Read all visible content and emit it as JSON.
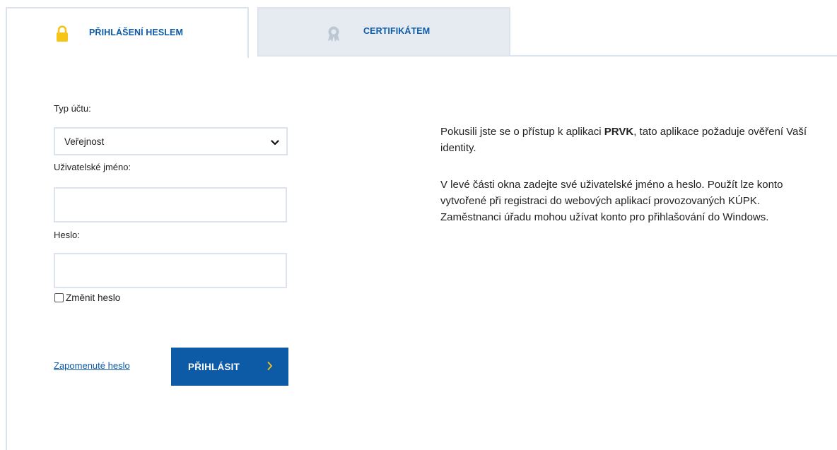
{
  "tabs": [
    {
      "label": "PŘIHLÁŠENÍ HESLEM",
      "icon": "lock-icon",
      "active": true
    },
    {
      "label": "CERTIFIKÁTEM",
      "icon": "certificate-icon",
      "active": false
    }
  ],
  "form": {
    "account_type_label": "Typ účtu:",
    "account_type_value": "Veřejnost",
    "username_label": "Uživatelské jméno:",
    "username_value": "",
    "password_label": "Heslo:",
    "password_value": "",
    "change_password_label": "Změnit heslo",
    "change_password_checked": false,
    "forgot_link": "Zapomenuté heslo",
    "login_button": "PŘIHLÁSIT",
    "login_button_arrow": "›"
  },
  "info": {
    "p1_before": "Pokusili jste se o přístup k aplikaci ",
    "p1_app": "PRVK",
    "p1_after": ", tato aplikace požaduje ověření Vaší identity.",
    "p2": "V levé části okna zadejte své uživatelské jméno a heslo. Použít lze konto vytvořené při registraci do webových aplikací provozovaných KÚPK. Zaměstnanci úřadu mohou užívat konto pro přihlašování do Windows."
  },
  "colors": {
    "accent": "#0d5aa7",
    "lock": "#f5c518",
    "tab_inactive_bg": "#e6ebf1",
    "border": "#dde3ec"
  }
}
